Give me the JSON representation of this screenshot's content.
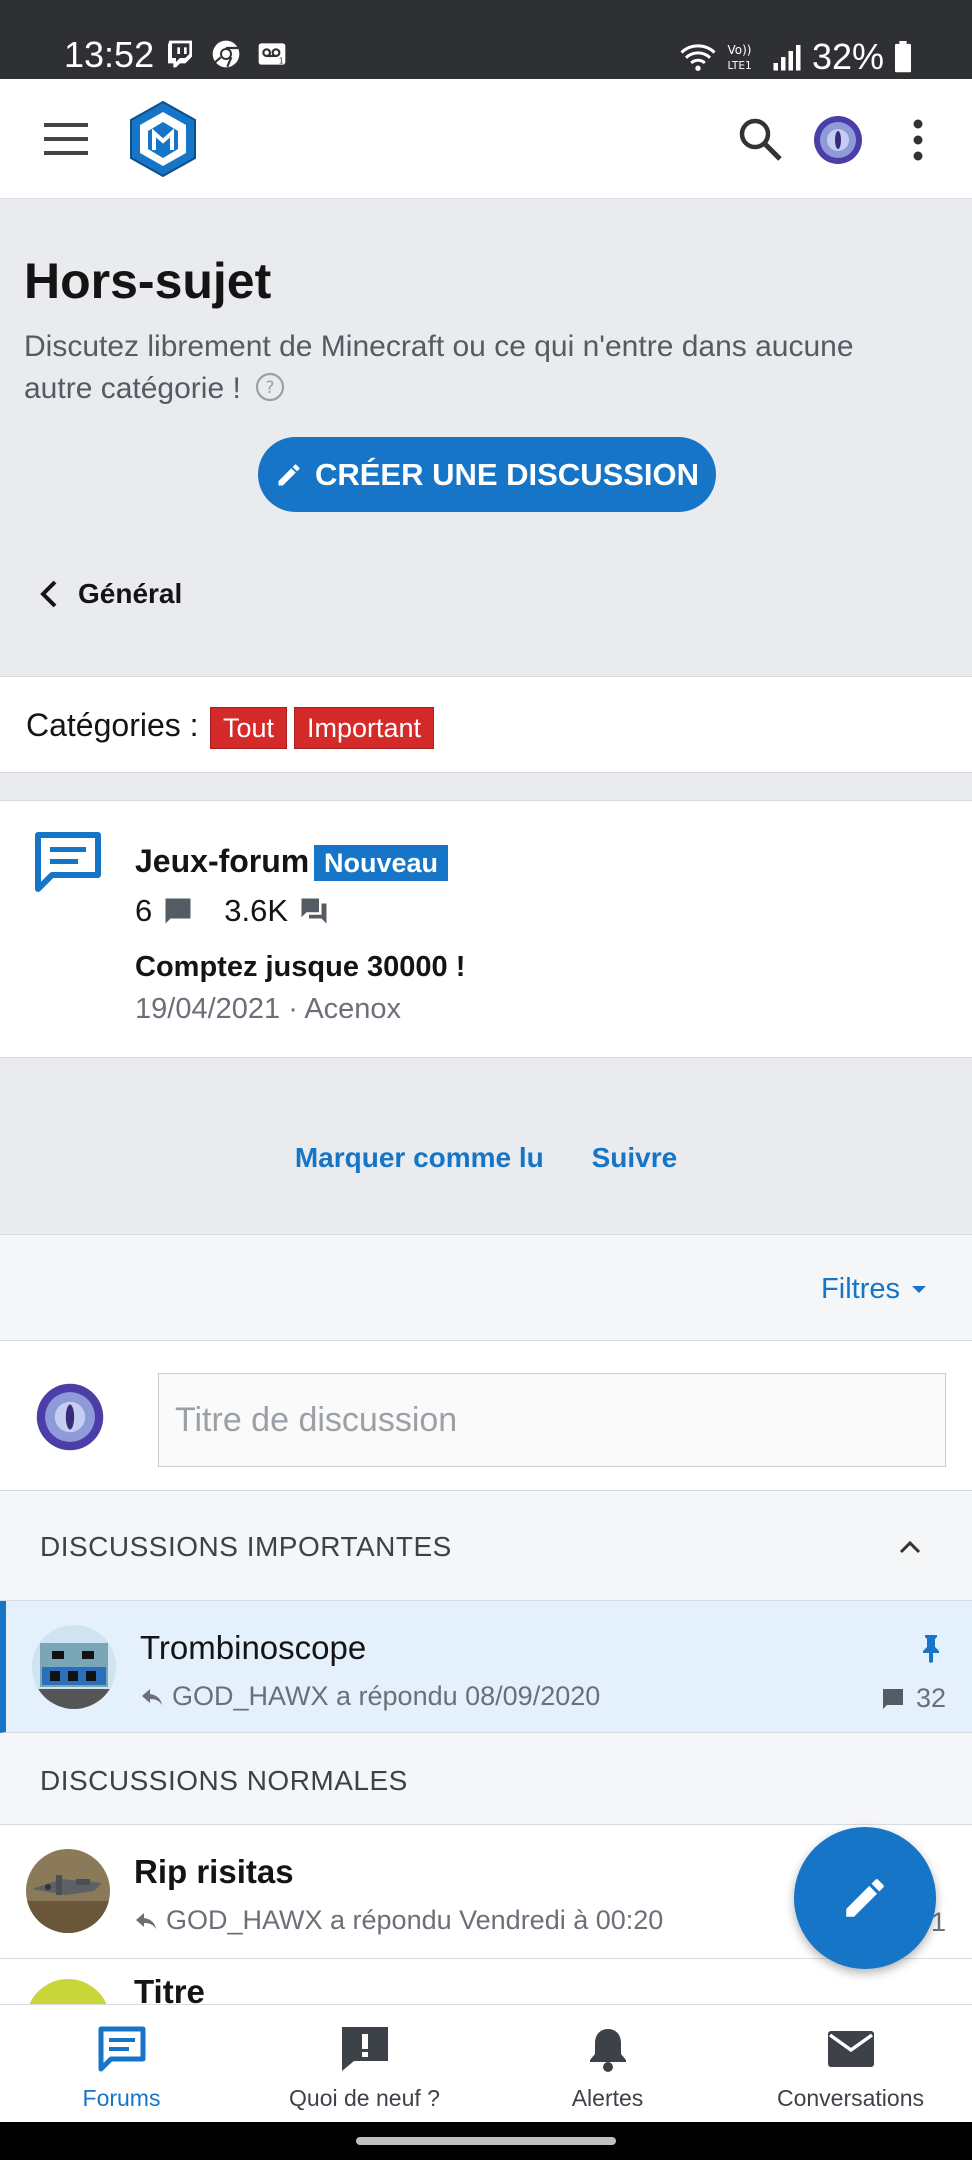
{
  "status_bar": {
    "time": "13:52",
    "battery": "32%",
    "network": "LTE1",
    "icons_left": [
      "twitch-icon",
      "chrome-icon",
      "voicemail-icon"
    ],
    "icons_right": [
      "wifi-icon",
      "volte-icon",
      "signal-icon",
      "battery-icon"
    ]
  },
  "header": {
    "icons": [
      "menu-icon",
      "site-logo",
      "search-icon",
      "user-avatar",
      "more-vert-icon"
    ]
  },
  "page": {
    "title": "Hors-sujet",
    "description": "Discutez librement de Minecraft ou ce qui n'entre dans aucune autre catégorie !",
    "create_button": "CRÉER UNE DISCUSSION",
    "back_link": "Général"
  },
  "categories": {
    "label": "Catégories :",
    "tags": [
      "Tout",
      "Important"
    ]
  },
  "subforum": {
    "title": "Jeux-forum",
    "badge": "Nouveau",
    "threads_count": "6",
    "messages_count": "3.6K",
    "latest_title": "Comptez jusque 30000 !",
    "latest_meta": "19/04/2021 · Acenox"
  },
  "actions": {
    "mark_read": "Marquer comme lu",
    "follow": "Suivre"
  },
  "list": {
    "filters": "Filtres",
    "title_placeholder": "Titre de discussion",
    "sticky_header": "DISCUSSIONS IMPORTANTES",
    "normal_header": "DISCUSSIONS NORMALES",
    "sticky_threads": [
      {
        "title": "Trombinoscope",
        "meta": "GOD_HAWX a répondu 08/09/2020",
        "replies": "32"
      }
    ],
    "normal_threads": [
      {
        "title": "Rip risitas",
        "meta": "GOD_HAWX a répondu Vendredi à 00:20",
        "replies": "1"
      },
      {
        "title": "Titre"
      }
    ]
  },
  "bottom_nav": {
    "items": [
      "Forums",
      "Quoi de neuf ?",
      "Alertes",
      "Conversations"
    ],
    "active": "Forums"
  },
  "colors": {
    "accent": "#1675c6",
    "tag_red": "#d52a2a",
    "sticky_bg": "#e4f0fb",
    "page_bg": "#e9ebee"
  }
}
